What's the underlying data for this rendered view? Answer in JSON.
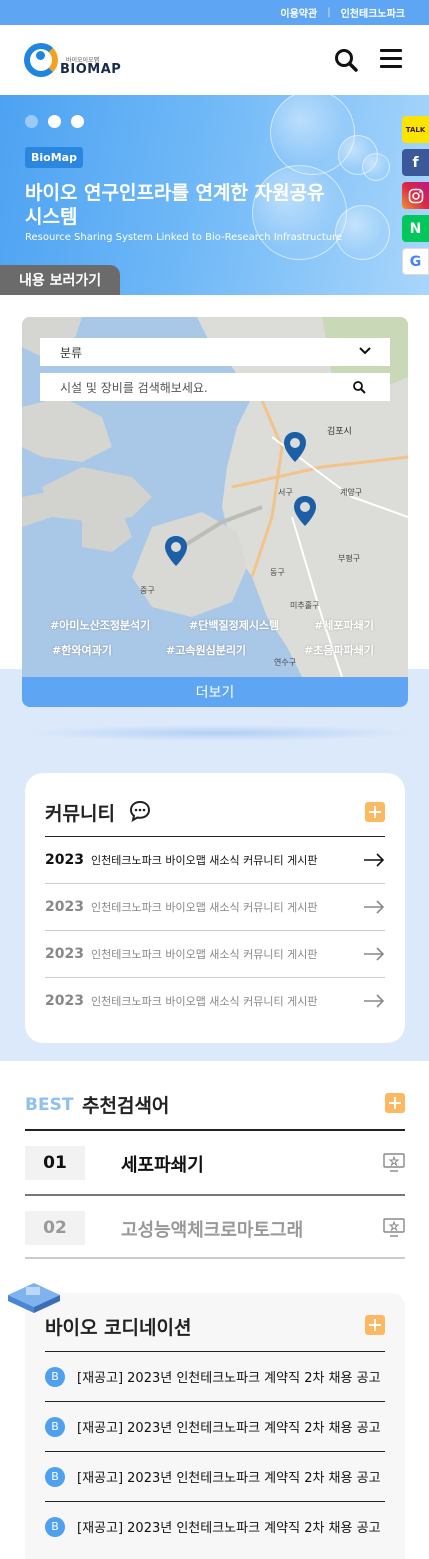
{
  "topbar": {
    "links": [
      "이용약관",
      "인천테크노파크"
    ],
    "separator": "|"
  },
  "header": {
    "logo_small": "바이오이오맵",
    "logo_text": "BIOMAP"
  },
  "hero": {
    "badge": "BioMap",
    "title": "바이오 연구인프라를 연계한 자원공유시스템",
    "subtitle": "Resource Sharing System Linked to Bio-Research Infrastructure",
    "goto_label": "내용 보러가기",
    "active_slide": 1,
    "slide_count": 3
  },
  "social": {
    "talk": "TALK",
    "facebook": "f",
    "naver": "N",
    "google": "G"
  },
  "map": {
    "select_label": "분류",
    "search_placeholder": "시설 및 장비를 검색해보세요.",
    "tags": [
      "#아미노산조정분석기",
      "#단백질정제시스템",
      "#세포파쇄기",
      "#한와여과기",
      "#고속원심분리기",
      "#초음파파쇄기"
    ],
    "more_label": "더보기",
    "place_labels": [
      "김포시",
      "계양구",
      "부평구",
      "서구",
      "중구",
      "동구",
      "미추홀구",
      "연수구"
    ]
  },
  "community": {
    "title": "커뮤니티",
    "rows": [
      {
        "year": "2023",
        "text": "인천테크노파크 바이오맵 새소식 커뮤니티 게시판",
        "active": true
      },
      {
        "year": "2023",
        "text": "인천테크노파크 바이오맵 새소식 커뮤니티 게시판",
        "active": false
      },
      {
        "year": "2023",
        "text": "인천테크노파크 바이오맵 새소식 커뮤니티 게시판",
        "active": false
      },
      {
        "year": "2023",
        "text": "인천테크노파크 바이오맵 새소식 커뮤니티 게시판",
        "active": false
      }
    ]
  },
  "best": {
    "label": "BEST",
    "title": "추천검색어",
    "items": [
      {
        "rank": "01",
        "name": "세포파쇄기"
      },
      {
        "rank": "02",
        "name": "고성능액체크로마토그래"
      }
    ]
  },
  "coord": {
    "title": "바이오 코디네이션",
    "icon_glyph": "B",
    "items": [
      "[재공고] 2023년 인천테크노파크 계약직 2차 채용 공고",
      "[재공고] 2023년 인천테크노파크 계약직 2차 채용 공고",
      "[재공고] 2023년 인천테크노파크 계약직 2차 채용 공고",
      "[재공고] 2023년 인천테크노파크 계약직 2차 채용 공고"
    ]
  },
  "colors": {
    "accent": "#5ea6f3",
    "orange": "#fdb961",
    "dark_badge": "#2a86df"
  }
}
